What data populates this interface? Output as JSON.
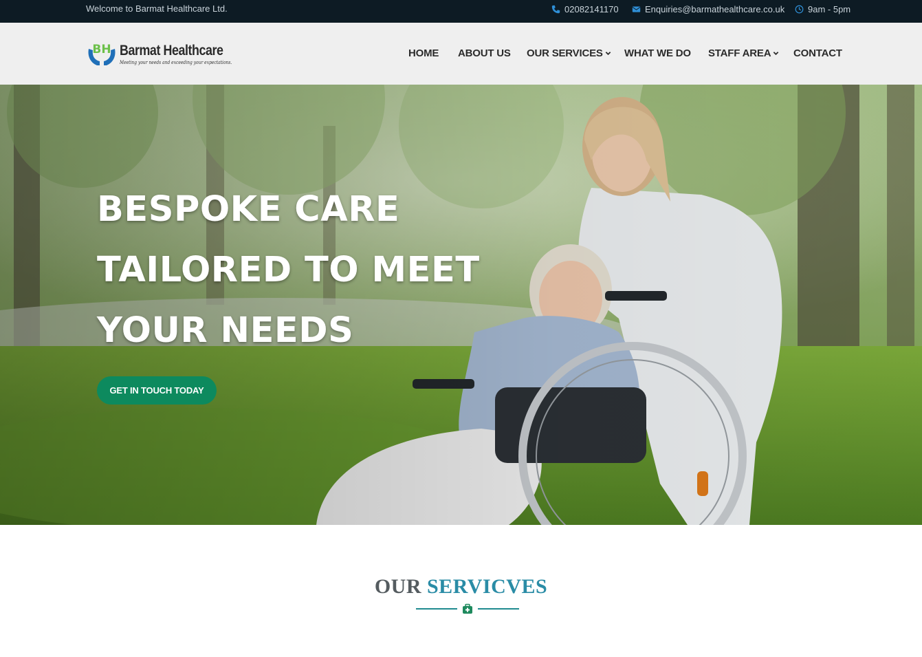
{
  "topbar": {
    "welcome": "Welcome to Barmat Healthcare Ltd.",
    "phone": "02082141170",
    "email": "Enquiries@barmathealthcare.co.uk",
    "hours": "9am - 5pm",
    "icon_color": "#2f8fd6"
  },
  "header": {
    "logo": {
      "name": "Barmat Healthcare",
      "tagline": "Meeting your needs and exceeding your expectations.",
      "monogram": "BH"
    },
    "nav": [
      {
        "label": "HOME",
        "dropdown": false
      },
      {
        "label": "ABOUT US",
        "dropdown": false
      },
      {
        "label": "OUR SERVICES",
        "dropdown": true
      },
      {
        "label": "WHAT WE DO",
        "dropdown": false
      },
      {
        "label": "STAFF AREA",
        "dropdown": true
      },
      {
        "label": "CONTACT",
        "dropdown": false
      }
    ]
  },
  "hero": {
    "lines": [
      "BESPOKE CARE",
      "TAILORED TO MEET",
      "YOUR NEEDS"
    ],
    "cta_label": "GET IN TOUCH TODAY",
    "cta_color": "#0d8a5e"
  },
  "services": {
    "title_part1": "OUR",
    "title_part2": "SERVICVES",
    "accent_color": "#2a8ca6"
  }
}
